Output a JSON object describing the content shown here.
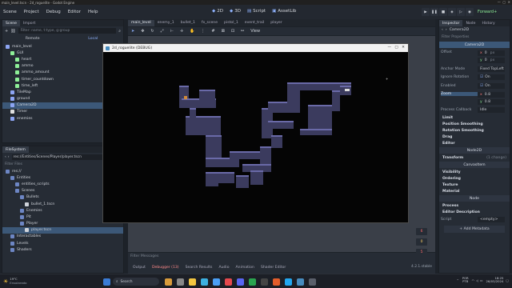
{
  "window_title": "main_level.tscn - 2d_roguelite - Godot Engine",
  "menu": [
    "Scene",
    "Project",
    "Debug",
    "Editor",
    "Help"
  ],
  "workspaces": {
    "d2": "2D",
    "d3": "3D",
    "script": "Script",
    "assetlib": "AssetLib"
  },
  "renderer": "Forward+",
  "scene_dock": {
    "tabs": [
      "Scene",
      "Import"
    ],
    "filter_placeholder": "Filter: name, t:type, g:group",
    "remote": "Remote",
    "local": "Local",
    "nodes": [
      {
        "label": "main_level",
        "color": "#8da5f3"
      },
      {
        "label": "GUI",
        "color": "#8eef97"
      },
      {
        "label": "heart",
        "color": "#8eef97"
      },
      {
        "label": "ammo",
        "color": "#8eef97"
      },
      {
        "label": "ammo_amount",
        "color": "#8eef97"
      },
      {
        "label": "timer_countdown",
        "color": "#8eef97"
      },
      {
        "label": "time_left",
        "color": "#8eef97"
      },
      {
        "label": "TileMap",
        "color": "#8da5f3"
      },
      {
        "label": "ground",
        "color": "#8da5f3"
      },
      {
        "label": "Camera2D",
        "color": "#8da5f3"
      },
      {
        "label": "Timer",
        "color": "#e0e0e0"
      },
      {
        "label": "enemies",
        "color": "#8da5f3"
      }
    ]
  },
  "filesystem": {
    "title": "FileSystem",
    "path": "res://Entities/Scenes/Player/player.tscn",
    "filter": "Filter Files",
    "items": [
      {
        "label": "res://",
        "depth": 0
      },
      {
        "label": "Entities",
        "depth": 1
      },
      {
        "label": "entities_scripts",
        "depth": 2
      },
      {
        "label": "Scenes",
        "depth": 2
      },
      {
        "label": "Bullets",
        "depth": 3
      },
      {
        "label": "bullet_1.tscn",
        "depth": 4
      },
      {
        "label": "Enemies",
        "depth": 3
      },
      {
        "label": "Pit",
        "depth": 3
      },
      {
        "label": "Player",
        "depth": 3
      },
      {
        "label": "player.tscn",
        "depth": 4
      },
      {
        "label": "Interactables",
        "depth": 1
      },
      {
        "label": "Levels",
        "depth": 1
      },
      {
        "label": "Shaders",
        "depth": 1
      }
    ]
  },
  "editor_tabs": [
    "main_level",
    "enemy_1",
    "bullet_1",
    "fx_scene",
    "pistol_1",
    "event_trail",
    "player"
  ],
  "toolbar_view": "View",
  "debug_window": {
    "title": "2d_roguelite (DEBUG)"
  },
  "bottom_panel": {
    "filter": "Filter Messages",
    "tabs": [
      "Output",
      "Debugger (13)",
      "Search Results",
      "Audio",
      "Animation",
      "Shader Editor"
    ],
    "version": "4.2.1.stable",
    "counts": [
      "6",
      "0",
      "5",
      "0"
    ]
  },
  "inspector": {
    "tabs": [
      "Inspector",
      "Node",
      "History"
    ],
    "node_name": "Camera2D",
    "filter": "Filter Properties",
    "class_header": "Camera2D",
    "offset_label": "Offset",
    "offset_x": "0",
    "offset_y": "0",
    "offset_unit": "px",
    "anchor_label": "Anchor Mode",
    "anchor_value": "Fixed TopLeft",
    "ignore_rot_label": "Ignore Rotation",
    "ignore_rot_value": "On",
    "enabled_label": "Enabled",
    "enabled_value": "On",
    "zoom_label": "Zoom",
    "zoom_x": "0.8",
    "zoom_y": "0.8",
    "process_label": "Process Callback",
    "process_value": "Idle",
    "groups": [
      "Limit",
      "Position Smoothing",
      "Rotation Smoothing",
      "Drag",
      "Editor"
    ],
    "node2d_header": "Node2D",
    "transform": "Transform",
    "transform_hint": "(1 change)",
    "canvas_header": "CanvasItem",
    "canvas_groups": [
      "Visibility",
      "Ordering",
      "Texture",
      "Material"
    ],
    "node_header": "Node",
    "node_groups": [
      "Process",
      "Editor Description"
    ],
    "script_label": "Script",
    "script_value": "<empty>",
    "add_metadata": "+ Add Metadata"
  },
  "taskbar": {
    "weather_temp": "19°C",
    "weather_desc": "Ensolarado",
    "search": "Search",
    "lang1": "POR",
    "lang2": "PTB",
    "time": "18:25",
    "date": "26/03/2024"
  }
}
